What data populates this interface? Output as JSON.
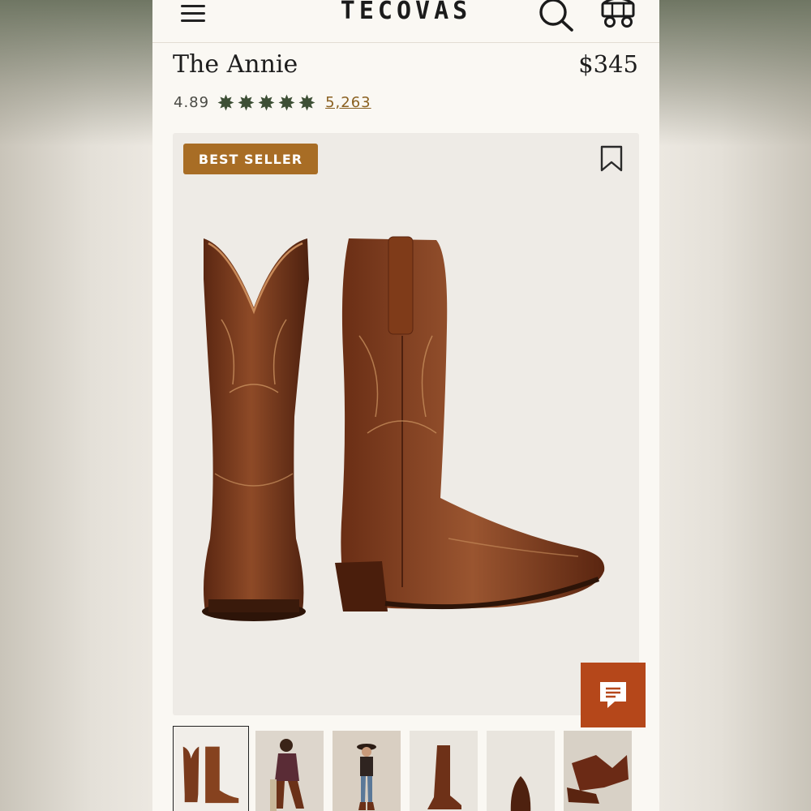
{
  "header": {
    "logo": "TECOVAS",
    "icons": [
      "menu-icon",
      "search-icon",
      "cart-wagon-icon"
    ]
  },
  "product": {
    "name": "The Annie",
    "price": "$345",
    "rating": "4.89",
    "review_count": "5,263",
    "stars": 5,
    "badge": "BEST SELLER"
  },
  "colors": {
    "badge": "#a86d25",
    "chat_button": "#b5471a",
    "star": "#3d4f35",
    "link": "#8a6020",
    "leather": "#7a3a1c"
  },
  "gallery": {
    "thumbnails": [
      {
        "label": "boots-pair",
        "active": true
      },
      {
        "label": "woman-seated-in-boots",
        "active": false
      },
      {
        "label": "woman-standing-in-hat",
        "active": false
      },
      {
        "label": "single-boot-side",
        "active": false
      },
      {
        "label": "boot-toe-top-view",
        "active": false
      },
      {
        "label": "boots-detail",
        "active": false
      }
    ]
  }
}
